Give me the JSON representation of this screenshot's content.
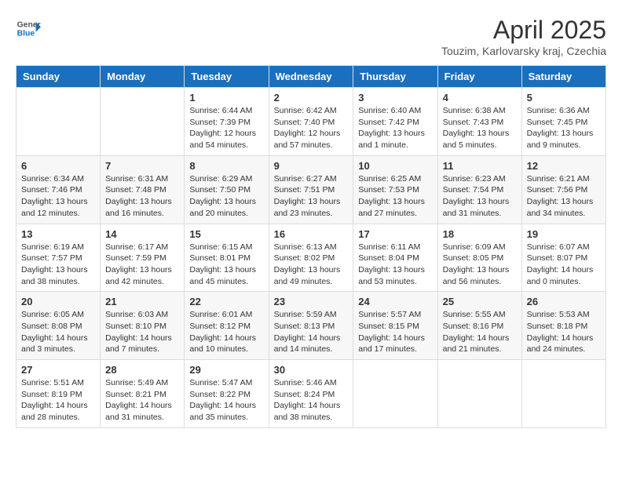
{
  "header": {
    "logo_line1": "General",
    "logo_line2": "Blue",
    "month_title": "April 2025",
    "subtitle": "Touzim, Karlovarsky kraj, Czechia"
  },
  "weekdays": [
    "Sunday",
    "Monday",
    "Tuesday",
    "Wednesday",
    "Thursday",
    "Friday",
    "Saturday"
  ],
  "weeks": [
    [
      {
        "day": "",
        "sunrise": "",
        "sunset": "",
        "daylight": ""
      },
      {
        "day": "",
        "sunrise": "",
        "sunset": "",
        "daylight": ""
      },
      {
        "day": "1",
        "sunrise": "Sunrise: 6:44 AM",
        "sunset": "Sunset: 7:39 PM",
        "daylight": "Daylight: 12 hours and 54 minutes."
      },
      {
        "day": "2",
        "sunrise": "Sunrise: 6:42 AM",
        "sunset": "Sunset: 7:40 PM",
        "daylight": "Daylight: 12 hours and 57 minutes."
      },
      {
        "day": "3",
        "sunrise": "Sunrise: 6:40 AM",
        "sunset": "Sunset: 7:42 PM",
        "daylight": "Daylight: 13 hours and 1 minute."
      },
      {
        "day": "4",
        "sunrise": "Sunrise: 6:38 AM",
        "sunset": "Sunset: 7:43 PM",
        "daylight": "Daylight: 13 hours and 5 minutes."
      },
      {
        "day": "5",
        "sunrise": "Sunrise: 6:36 AM",
        "sunset": "Sunset: 7:45 PM",
        "daylight": "Daylight: 13 hours and 9 minutes."
      }
    ],
    [
      {
        "day": "6",
        "sunrise": "Sunrise: 6:34 AM",
        "sunset": "Sunset: 7:46 PM",
        "daylight": "Daylight: 13 hours and 12 minutes."
      },
      {
        "day": "7",
        "sunrise": "Sunrise: 6:31 AM",
        "sunset": "Sunset: 7:48 PM",
        "daylight": "Daylight: 13 hours and 16 minutes."
      },
      {
        "day": "8",
        "sunrise": "Sunrise: 6:29 AM",
        "sunset": "Sunset: 7:50 PM",
        "daylight": "Daylight: 13 hours and 20 minutes."
      },
      {
        "day": "9",
        "sunrise": "Sunrise: 6:27 AM",
        "sunset": "Sunset: 7:51 PM",
        "daylight": "Daylight: 13 hours and 23 minutes."
      },
      {
        "day": "10",
        "sunrise": "Sunrise: 6:25 AM",
        "sunset": "Sunset: 7:53 PM",
        "daylight": "Daylight: 13 hours and 27 minutes."
      },
      {
        "day": "11",
        "sunrise": "Sunrise: 6:23 AM",
        "sunset": "Sunset: 7:54 PM",
        "daylight": "Daylight: 13 hours and 31 minutes."
      },
      {
        "day": "12",
        "sunrise": "Sunrise: 6:21 AM",
        "sunset": "Sunset: 7:56 PM",
        "daylight": "Daylight: 13 hours and 34 minutes."
      }
    ],
    [
      {
        "day": "13",
        "sunrise": "Sunrise: 6:19 AM",
        "sunset": "Sunset: 7:57 PM",
        "daylight": "Daylight: 13 hours and 38 minutes."
      },
      {
        "day": "14",
        "sunrise": "Sunrise: 6:17 AM",
        "sunset": "Sunset: 7:59 PM",
        "daylight": "Daylight: 13 hours and 42 minutes."
      },
      {
        "day": "15",
        "sunrise": "Sunrise: 6:15 AM",
        "sunset": "Sunset: 8:01 PM",
        "daylight": "Daylight: 13 hours and 45 minutes."
      },
      {
        "day": "16",
        "sunrise": "Sunrise: 6:13 AM",
        "sunset": "Sunset: 8:02 PM",
        "daylight": "Daylight: 13 hours and 49 minutes."
      },
      {
        "day": "17",
        "sunrise": "Sunrise: 6:11 AM",
        "sunset": "Sunset: 8:04 PM",
        "daylight": "Daylight: 13 hours and 53 minutes."
      },
      {
        "day": "18",
        "sunrise": "Sunrise: 6:09 AM",
        "sunset": "Sunset: 8:05 PM",
        "daylight": "Daylight: 13 hours and 56 minutes."
      },
      {
        "day": "19",
        "sunrise": "Sunrise: 6:07 AM",
        "sunset": "Sunset: 8:07 PM",
        "daylight": "Daylight: 14 hours and 0 minutes."
      }
    ],
    [
      {
        "day": "20",
        "sunrise": "Sunrise: 6:05 AM",
        "sunset": "Sunset: 8:08 PM",
        "daylight": "Daylight: 14 hours and 3 minutes."
      },
      {
        "day": "21",
        "sunrise": "Sunrise: 6:03 AM",
        "sunset": "Sunset: 8:10 PM",
        "daylight": "Daylight: 14 hours and 7 minutes."
      },
      {
        "day": "22",
        "sunrise": "Sunrise: 6:01 AM",
        "sunset": "Sunset: 8:12 PM",
        "daylight": "Daylight: 14 hours and 10 minutes."
      },
      {
        "day": "23",
        "sunrise": "Sunrise: 5:59 AM",
        "sunset": "Sunset: 8:13 PM",
        "daylight": "Daylight: 14 hours and 14 minutes."
      },
      {
        "day": "24",
        "sunrise": "Sunrise: 5:57 AM",
        "sunset": "Sunset: 8:15 PM",
        "daylight": "Daylight: 14 hours and 17 minutes."
      },
      {
        "day": "25",
        "sunrise": "Sunrise: 5:55 AM",
        "sunset": "Sunset: 8:16 PM",
        "daylight": "Daylight: 14 hours and 21 minutes."
      },
      {
        "day": "26",
        "sunrise": "Sunrise: 5:53 AM",
        "sunset": "Sunset: 8:18 PM",
        "daylight": "Daylight: 14 hours and 24 minutes."
      }
    ],
    [
      {
        "day": "27",
        "sunrise": "Sunrise: 5:51 AM",
        "sunset": "Sunset: 8:19 PM",
        "daylight": "Daylight: 14 hours and 28 minutes."
      },
      {
        "day": "28",
        "sunrise": "Sunrise: 5:49 AM",
        "sunset": "Sunset: 8:21 PM",
        "daylight": "Daylight: 14 hours and 31 minutes."
      },
      {
        "day": "29",
        "sunrise": "Sunrise: 5:47 AM",
        "sunset": "Sunset: 8:22 PM",
        "daylight": "Daylight: 14 hours and 35 minutes."
      },
      {
        "day": "30",
        "sunrise": "Sunrise: 5:46 AM",
        "sunset": "Sunset: 8:24 PM",
        "daylight": "Daylight: 14 hours and 38 minutes."
      },
      {
        "day": "",
        "sunrise": "",
        "sunset": "",
        "daylight": ""
      },
      {
        "day": "",
        "sunrise": "",
        "sunset": "",
        "daylight": ""
      },
      {
        "day": "",
        "sunrise": "",
        "sunset": "",
        "daylight": ""
      }
    ]
  ]
}
